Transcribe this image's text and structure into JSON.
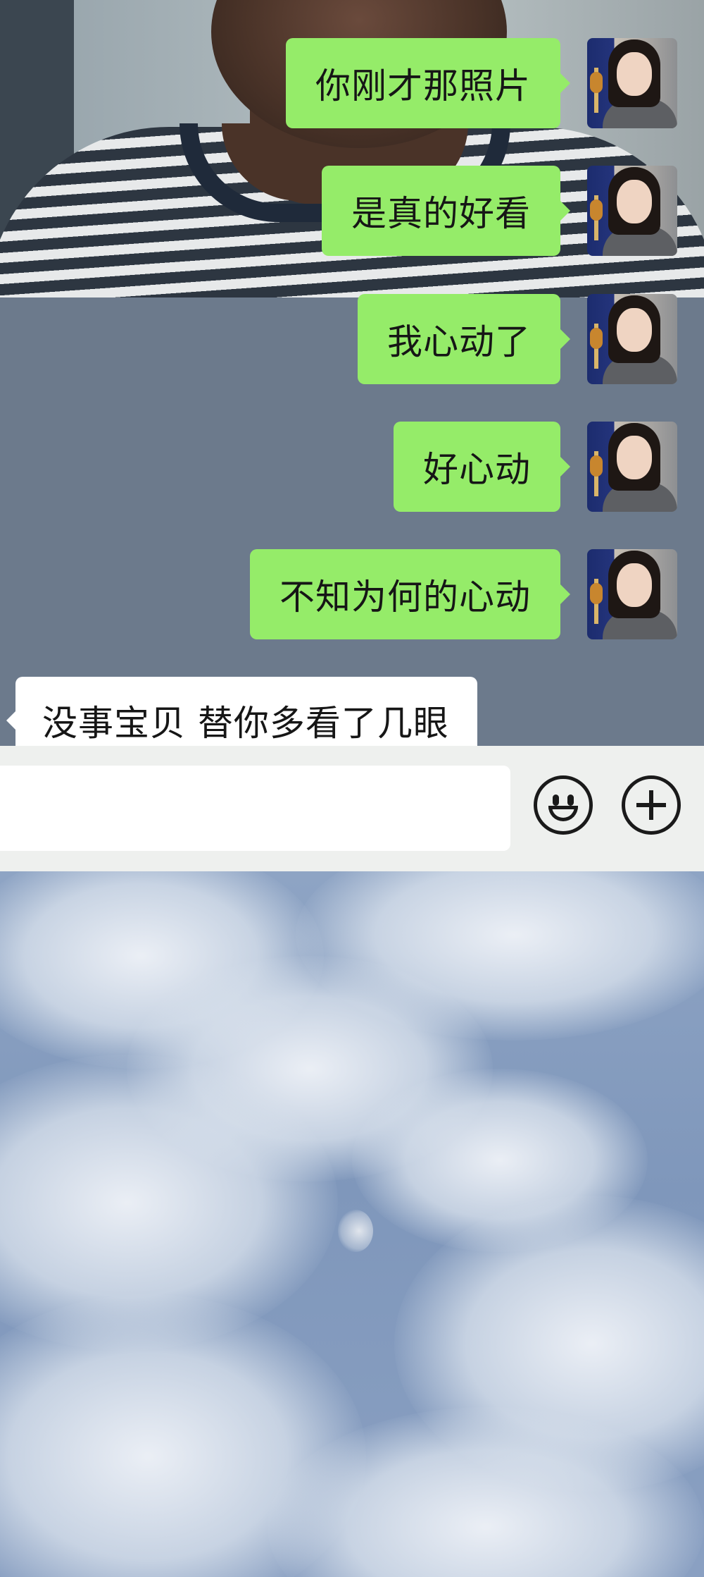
{
  "chat": {
    "outgoing_messages": [
      {
        "text": "你刚才那照片"
      },
      {
        "text": "是真的好看"
      },
      {
        "text": "我心动了"
      },
      {
        "text": "好心动"
      },
      {
        "text": "不知为何的心动"
      }
    ],
    "incoming_messages": [
      {
        "text": "没事宝贝 替你多看了几眼"
      }
    ]
  },
  "input_bar": {
    "value": "",
    "emoji_icon": "emoji-smile-icon",
    "more_icon": "plus-circle-icon"
  },
  "colors": {
    "outgoing_bubble": "#95ec69",
    "incoming_bubble": "#ffffff",
    "chat_background": "#6c7a8c",
    "input_bar_background": "#eef0ee"
  }
}
